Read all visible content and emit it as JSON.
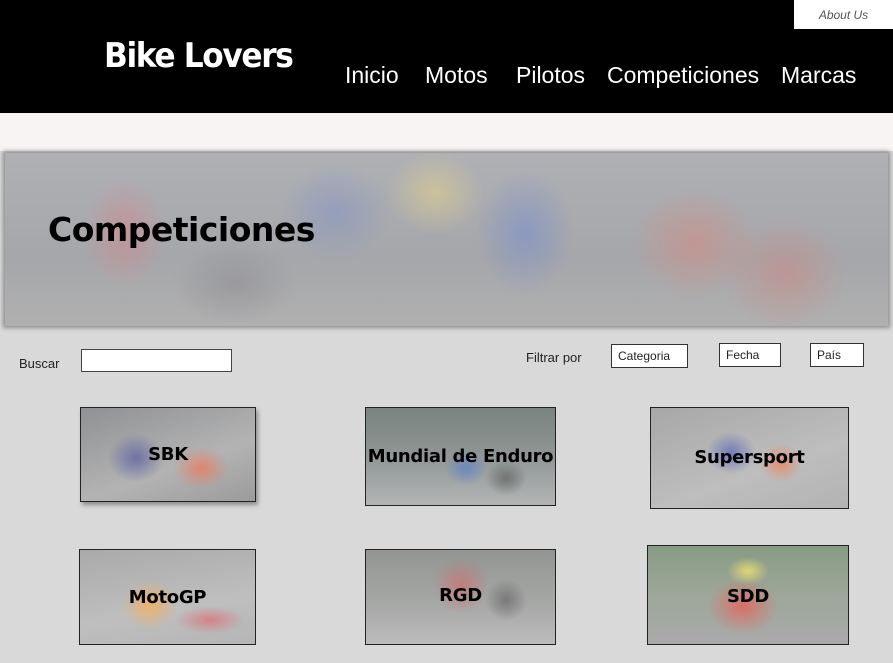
{
  "header": {
    "brand": "Bike Lovers",
    "about_label": "About Us",
    "nav": [
      {
        "label": "Inicio"
      },
      {
        "label": "Motos"
      },
      {
        "label": "Pilotos"
      },
      {
        "label": "Competiciones"
      },
      {
        "label": "Marcas"
      }
    ]
  },
  "banner": {
    "title": "Competiciones"
  },
  "search": {
    "label": "Buscar",
    "value": ""
  },
  "filters": {
    "label": "Filtrar por",
    "options": [
      {
        "label": "Categoria"
      },
      {
        "label": "Fecha"
      },
      {
        "label": "País"
      }
    ]
  },
  "competitions": [
    {
      "label": "SBK"
    },
    {
      "label": "Mundial de Enduro"
    },
    {
      "label": "Supersport"
    },
    {
      "label": "MotoGP"
    },
    {
      "label": "RGD"
    },
    {
      "label": "SDD"
    }
  ]
}
